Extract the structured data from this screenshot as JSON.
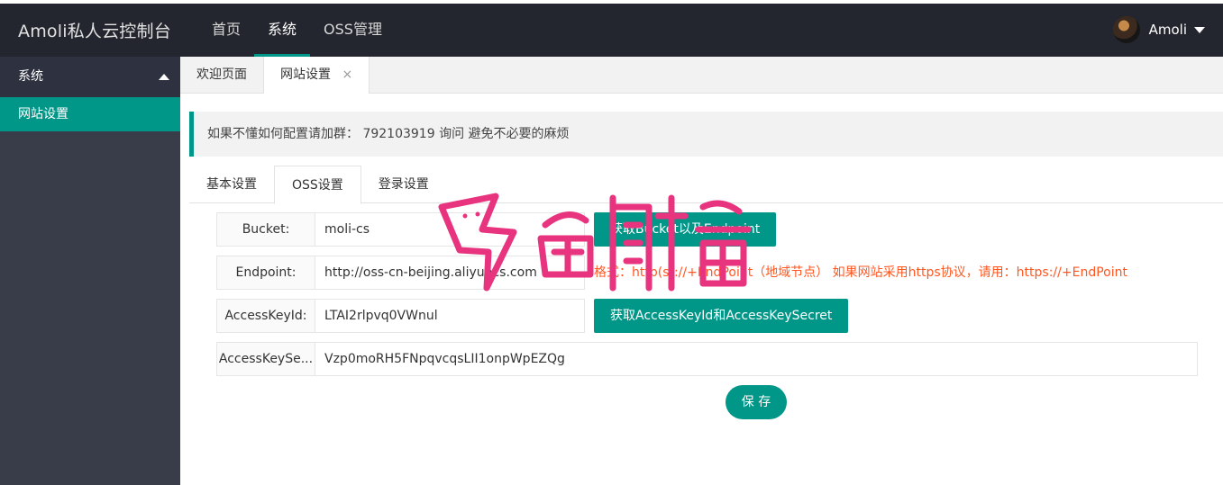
{
  "header": {
    "logo": "Amoli私人云控制台",
    "nav": [
      "首页",
      "系统",
      "OSS管理"
    ],
    "active_nav": "系统",
    "user_name": "Amoli"
  },
  "sidebar": {
    "group_label": "系统",
    "items": [
      {
        "label": "网站设置"
      }
    ]
  },
  "tabbar": {
    "tabs": [
      {
        "label": "欢迎页面"
      },
      {
        "label": "网站设置",
        "close": "×"
      }
    ]
  },
  "notice": "如果不懂如何配置请加群： 792103919 询问 避免不必要的麻烦",
  "inner_tabs": [
    "基本设置",
    "OSS设置",
    "登录设置"
  ],
  "form": {
    "bucket": {
      "label": "Bucket:",
      "value": "moli-cs"
    },
    "endpoint": {
      "label": "Endpoint:",
      "value": "http://oss-cn-beijing.aliyuncs.com"
    },
    "access_key_id": {
      "label": "AccessKeyId:",
      "value": "LTAI2rlpvq0VWnul"
    },
    "access_key_secret": {
      "label": "AccessKeySe...",
      "value": "Vzp0moRH5FNpqvcqsLII1onpWpEZQg"
    },
    "btn_get_bucket": "获取Bucket以及Endpoint",
    "btn_get_key": "获取AccessKeyId和AccessKeySecret",
    "endpoint_hint": "格式：http(s)://+EndPoint（地域节点） 如果网站采用https协议，请用：https://+EndPoint",
    "save": "保 存"
  },
  "colors": {
    "accent": "#009688",
    "header": "#23262e",
    "sidebar": "#393d49",
    "hint": "#ff5722",
    "watermark": "#e8337e"
  }
}
